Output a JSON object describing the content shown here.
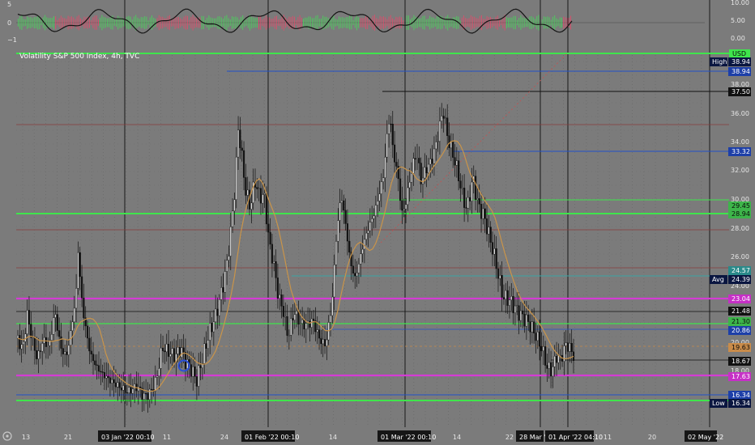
{
  "chart_data": {
    "type": "candlestick",
    "title": "Volatility S&P 500 Index, 4h, TVC",
    "currency": "USD",
    "oscillator": {
      "y_ticks": [
        "10.00",
        "5.00",
        "0.00"
      ],
      "left_ticks": [
        "5",
        "0",
        "−1"
      ]
    },
    "y_axis": {
      "min": 15.0,
      "max": 40.0,
      "ticks": [
        "38.00",
        "36.00",
        "34.00",
        "32.00",
        "30.00",
        "28.00",
        "26.00",
        "24.00",
        "20.00",
        "18.00"
      ]
    },
    "x_axis": {
      "ticks": [
        "13",
        "21",
        "11",
        "24",
        "14",
        "14",
        "22",
        "11",
        "20"
      ],
      "highlighted": [
        "03 Jan '22  00:10",
        "01 Feb '22  00:10",
        "01 Mar '22  00:10",
        "28 Mar '22",
        "01 Apr '22  04:10",
        "02 May '22"
      ]
    },
    "price_series": [
      [
        0,
        21.0
      ],
      [
        6,
        20.2
      ],
      [
        12,
        22.6
      ],
      [
        18,
        21.0
      ],
      [
        25,
        19.6
      ],
      [
        32,
        20.9
      ],
      [
        40,
        20.4
      ],
      [
        47,
        22.8
      ],
      [
        55,
        20.3
      ],
      [
        62,
        19.8
      ],
      [
        68,
        21.6
      ],
      [
        74,
        23.8
      ],
      [
        77,
        27.1
      ],
      [
        80,
        24.4
      ],
      [
        84,
        22.5
      ],
      [
        92,
        20.0
      ],
      [
        100,
        19.1
      ],
      [
        108,
        18.6
      ],
      [
        117,
        18.2
      ],
      [
        128,
        17.8
      ],
      [
        140,
        17.4
      ],
      [
        152,
        17.8
      ],
      [
        160,
        17.1
      ],
      [
        168,
        17.3
      ],
      [
        176,
        18.1
      ],
      [
        184,
        20.4
      ],
      [
        192,
        20.1
      ],
      [
        200,
        19.8
      ],
      [
        208,
        20.3
      ],
      [
        214,
        19.4
      ],
      [
        220,
        19.0
      ],
      [
        228,
        18.2
      ],
      [
        236,
        19.8
      ],
      [
        244,
        21.4
      ],
      [
        252,
        22.5
      ],
      [
        260,
        24.2
      ],
      [
        266,
        25.8
      ],
      [
        272,
        28.5
      ],
      [
        277,
        31.4
      ],
      [
        281,
        35.2
      ],
      [
        285,
        33.4
      ],
      [
        290,
        31.0
      ],
      [
        296,
        29.8
      ],
      [
        302,
        31.6
      ],
      [
        308,
        30.5
      ],
      [
        314,
        30.6
      ],
      [
        320,
        27.5
      ],
      [
        326,
        26.0
      ],
      [
        332,
        23.8
      ],
      [
        338,
        22.9
      ],
      [
        344,
        21.1
      ],
      [
        352,
        22.8
      ],
      [
        360,
        22.0
      ],
      [
        368,
        21.9
      ],
      [
        376,
        22.2
      ],
      [
        384,
        21.0
      ],
      [
        392,
        20.5
      ],
      [
        400,
        23.2
      ],
      [
        406,
        28.0
      ],
      [
        412,
        30.7
      ],
      [
        418,
        28.5
      ],
      [
        424,
        26.0
      ],
      [
        430,
        25.0
      ],
      [
        436,
        26.4
      ],
      [
        442,
        27.7
      ],
      [
        448,
        28.6
      ],
      [
        454,
        29.4
      ],
      [
        460,
        30.6
      ],
      [
        466,
        32.0
      ],
      [
        470,
        34.4
      ],
      [
        474,
        36.1
      ],
      [
        478,
        33.6
      ],
      [
        484,
        32.0
      ],
      [
        490,
        29.2
      ],
      [
        496,
        30.6
      ],
      [
        502,
        32.4
      ],
      [
        508,
        33.5
      ],
      [
        514,
        31.5
      ],
      [
        520,
        32.4
      ],
      [
        526,
        32.8
      ],
      [
        532,
        33.8
      ],
      [
        538,
        35.4
      ],
      [
        542,
        36.3
      ],
      [
        548,
        34.4
      ],
      [
        554,
        33.4
      ],
      [
        560,
        32.3
      ],
      [
        566,
        30.7
      ],
      [
        572,
        29.6
      ],
      [
        580,
        31.8
      ],
      [
        586,
        30.0
      ],
      [
        594,
        29.2
      ],
      [
        600,
        28.0
      ],
      [
        606,
        26.8
      ],
      [
        612,
        25.3
      ],
      [
        618,
        23.8
      ],
      [
        626,
        23.6
      ],
      [
        634,
        23.0
      ],
      [
        642,
        22.5
      ],
      [
        650,
        22.1
      ],
      [
        656,
        21.6
      ],
      [
        662,
        21.0
      ],
      [
        668,
        20.3
      ],
      [
        674,
        19.1
      ],
      [
        680,
        18.8
      ],
      [
        686,
        19.8
      ],
      [
        692,
        19.6
      ],
      [
        698,
        20.6
      ],
      [
        703,
        20.4
      ],
      [
        708,
        19.8
      ]
    ],
    "horizontal_levels": [
      {
        "label": "High",
        "value": "38.94",
        "color": "#0a1640",
        "tag": "High"
      },
      {
        "label": "38.94",
        "value": "38.94",
        "color": "#1d3fa8"
      },
      {
        "label": "37.50",
        "value": "37.50",
        "color": "#111111"
      },
      {
        "label": "33.32",
        "value": "33.32",
        "color": "#1d3fa8"
      },
      {
        "label": "29.45",
        "value": "29.45",
        "color": "#3db54a"
      },
      {
        "label": "28.94",
        "value": "28.94",
        "color": "#3db54a"
      },
      {
        "label": "24.57",
        "value": "24.57",
        "color": "#2a8a8a"
      },
      {
        "label": "Avg",
        "value": "24.39",
        "color": "#0a1640",
        "tag": "Avg"
      },
      {
        "label": "23.04",
        "value": "23.04",
        "color": "#c630c6"
      },
      {
        "label": "21.48",
        "value": "21.48",
        "color": "#111111"
      },
      {
        "label": "21.30",
        "value": "21.30",
        "color": "#3db54a"
      },
      {
        "label": "20.86",
        "value": "20.86",
        "color": "#1d3fa8"
      },
      {
        "label": "19.63",
        "value": "19.63",
        "color": "#c98c4a"
      },
      {
        "label": "18.67",
        "value": "18.67",
        "color": "#111111"
      },
      {
        "label": "17.63",
        "value": "17.63",
        "color": "#c630c6"
      },
      {
        "label": "16.34",
        "value": "16.34",
        "color": "#1d3fa8"
      },
      {
        "label": "Low",
        "value": "16.34",
        "color": "#0a1640",
        "tag": "Low"
      }
    ],
    "legend": "none",
    "grid": true
  }
}
